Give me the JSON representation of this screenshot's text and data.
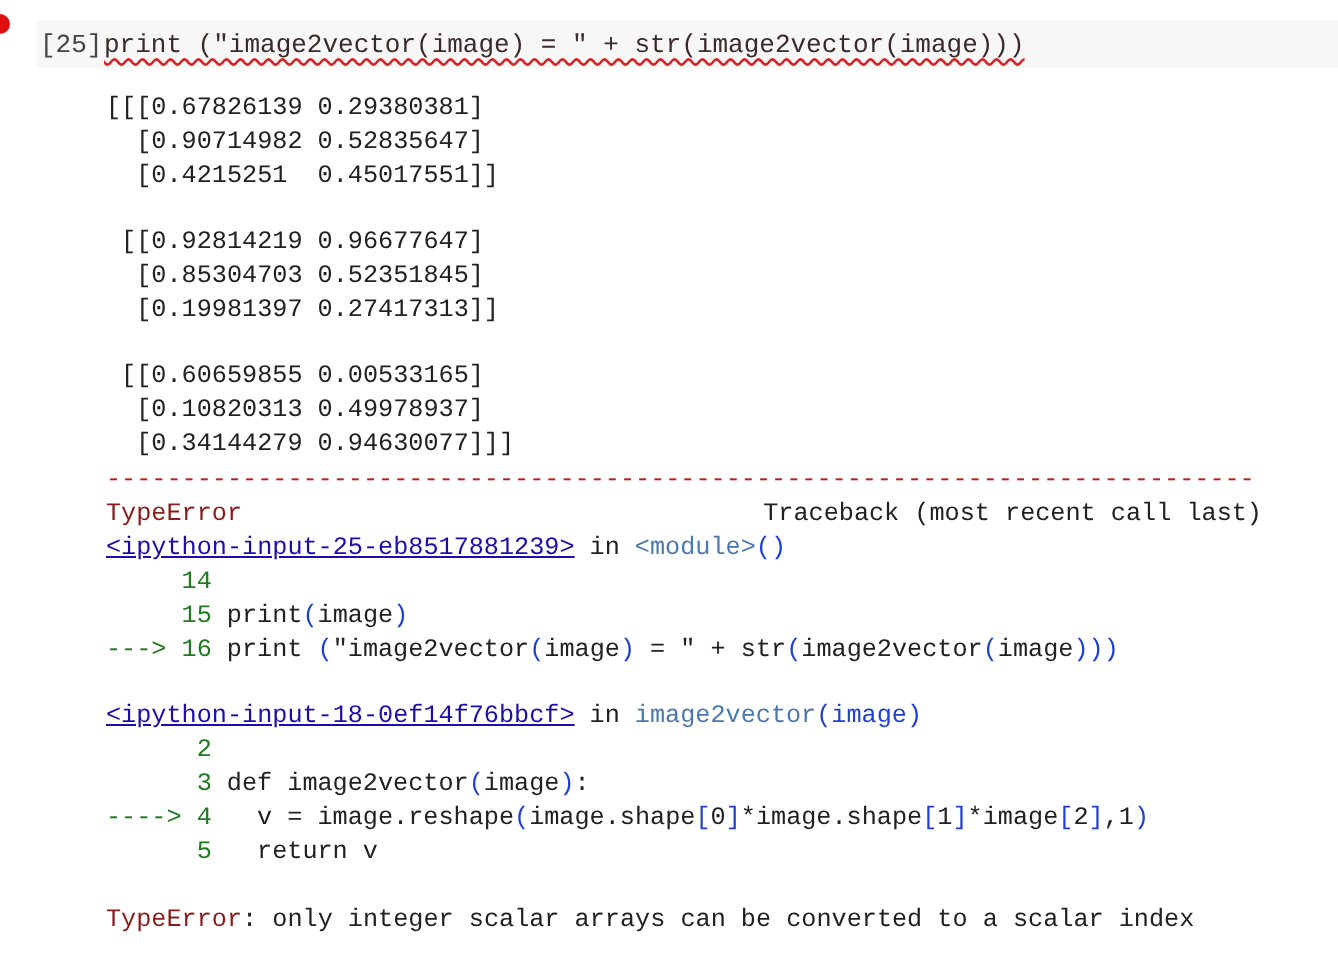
{
  "cell": {
    "prompt": "[25]",
    "code": "print (\"image2vector(image) = \" + str(image2vector(image)))",
    "error": true,
    "lint_warning": true
  },
  "stdout_blocks": [
    [
      "[[[0.67826139 0.29380381]",
      "  [0.90714982 0.52835647]",
      "  [0.4215251  0.45017551]]"
    ],
    [
      " [[0.92814219 0.96677647]",
      "  [0.85304703 0.52351845]",
      "  [0.19981397 0.27417313]]"
    ],
    [
      " [[0.60659855 0.00533165]",
      "  [0.10820313 0.49978937]",
      "  [0.34144279 0.94630077]]]"
    ]
  ],
  "traceback": {
    "separator": "----------------------------------------------------------------------------",
    "error_name": "TypeError",
    "title": "Traceback (most recent call last)",
    "frames": [
      {
        "file": "<ipython-input-25-eb8517881239>",
        "in": "in",
        "scope": "<module>",
        "args": "()",
        "lines": [
          {
            "number": "14"
          },
          {
            "number": "15",
            "code": "print(image)"
          },
          {
            "number": "16",
            "arrow": "--->",
            "code": "print (\"image2vector(image) = \" + str(image2vector(image)))"
          }
        ]
      },
      {
        "file": "<ipython-input-18-0ef14f76bbcf>",
        "in": "in",
        "scope": "image2vector",
        "args": "(image)",
        "lines": [
          {
            "number": "2"
          },
          {
            "number": "3",
            "code": "def image2vector(image):"
          },
          {
            "number": "4",
            "arrow": "---->",
            "code": "  v = image.reshape(image.shape[0]*image.shape[1]*image[2],1)"
          },
          {
            "number": "5",
            "code": "  return v"
          }
        ]
      }
    ],
    "error_line_name": "TypeError",
    "error_message": ": only integer scalar arrays can be converted to a scalar index"
  }
}
